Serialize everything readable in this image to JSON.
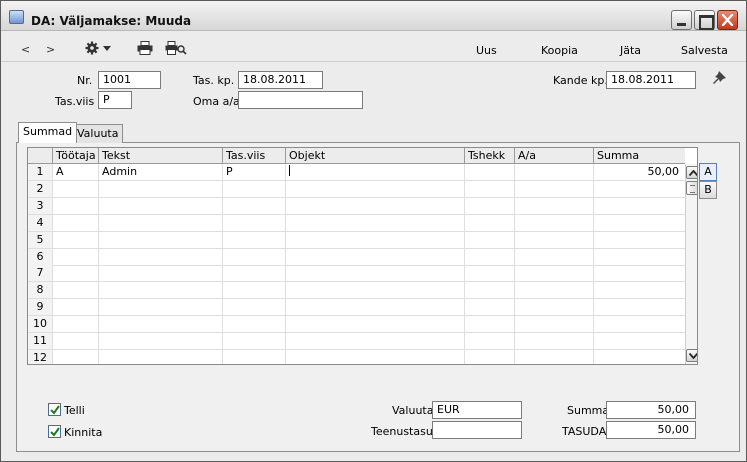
{
  "window": {
    "title": "DA: Väljamakse: Muuda"
  },
  "toolbar": {
    "back": "<",
    "forward": ">",
    "icons": [
      "gear-icon",
      "printer-icon",
      "print-preview-icon"
    ],
    "commands": {
      "uus": "Uus",
      "koopia": "Koopia",
      "jata": "Jäta",
      "salvesta": "Salvesta"
    }
  },
  "header": {
    "nr_label": "Nr.",
    "nr_value": "1001",
    "tas_kp_label": "Tas. kp.",
    "tas_kp_value": "18.08.2011",
    "kande_kp_label": "Kande kp.",
    "kande_kp_value": "18.08.2011",
    "tas_viis_label": "Tas.viis",
    "tas_viis_value": "P",
    "oma_aa_label": "Oma a/a",
    "oma_aa_value": ""
  },
  "tabs": {
    "summad": "Summad",
    "valuuta": "Valuuta"
  },
  "grid": {
    "columns": [
      "Töötaja",
      "Tekst",
      "Tas.viis",
      "Objekt",
      "Tshekk",
      "A/a",
      "Summa"
    ],
    "rows": [
      {
        "n": "1",
        "cells": [
          "A",
          "Admin",
          "P",
          "",
          "",
          "",
          "50,00"
        ]
      },
      {
        "n": "2",
        "cells": [
          "",
          "",
          "",
          "",
          "",
          "",
          ""
        ]
      },
      {
        "n": "3",
        "cells": [
          "",
          "",
          "",
          "",
          "",
          "",
          ""
        ]
      },
      {
        "n": "4",
        "cells": [
          "",
          "",
          "",
          "",
          "",
          "",
          ""
        ]
      },
      {
        "n": "5",
        "cells": [
          "",
          "",
          "",
          "",
          "",
          "",
          ""
        ]
      },
      {
        "n": "6",
        "cells": [
          "",
          "",
          "",
          "",
          "",
          "",
          ""
        ]
      },
      {
        "n": "7",
        "cells": [
          "",
          "",
          "",
          "",
          "",
          "",
          ""
        ]
      },
      {
        "n": "8",
        "cells": [
          "",
          "",
          "",
          "",
          "",
          "",
          ""
        ]
      },
      {
        "n": "9",
        "cells": [
          "",
          "",
          "",
          "",
          "",
          "",
          ""
        ]
      },
      {
        "n": "10",
        "cells": [
          "",
          "",
          "",
          "",
          "",
          "",
          ""
        ]
      },
      {
        "n": "11",
        "cells": [
          "",
          "",
          "",
          "",
          "",
          "",
          ""
        ]
      },
      {
        "n": "12",
        "cells": [
          "",
          "",
          "",
          "",
          "",
          "",
          ""
        ]
      }
    ],
    "side_buttons": [
      "A",
      "B"
    ]
  },
  "footer": {
    "telli_label": "Telli",
    "telli_checked": true,
    "kinnita_label": "Kinnita",
    "kinnita_checked": true,
    "valuuta_label": "Valuuta",
    "valuuta_value": "EUR",
    "teenustasu_label": "Teenustasu",
    "teenustasu_value": "",
    "summa_label": "Summa",
    "summa_value": "50,00",
    "tasuda_label": "TASUDA",
    "tasuda_value": "50,00"
  },
  "colors": {
    "title_bg": "#e2e2e2",
    "close_button": "#c8472b",
    "selected_side_button": "#e8f0fc"
  }
}
